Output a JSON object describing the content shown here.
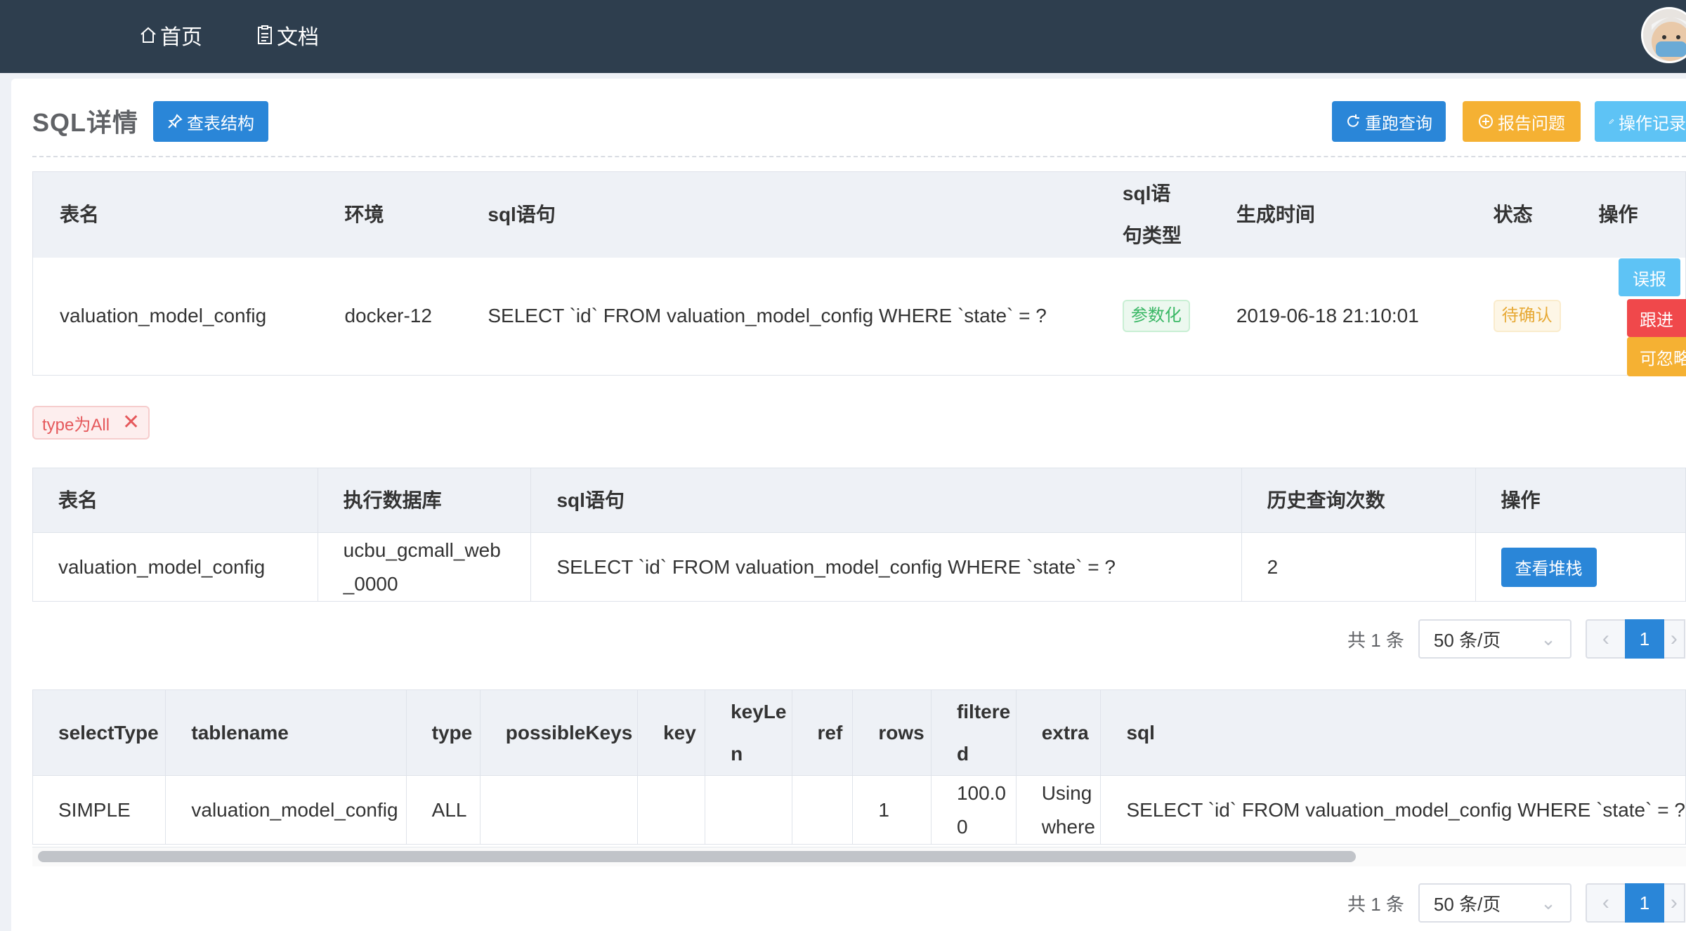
{
  "nav": {
    "home_label": "首页",
    "docs_label": "文档"
  },
  "header": {
    "title": "SQL详情",
    "view_structure_label": "查表结构",
    "rerun_label": "重跑查询",
    "report_label": "报告问题",
    "log_label": "操作记录"
  },
  "summary_table": {
    "headers": [
      "表名",
      "环境",
      "sql语句",
      "sql语句类型",
      "生成时间",
      "状态",
      "操作"
    ],
    "sql_type_header_line1": "sql语",
    "sql_type_header_line2": "句类型",
    "row": {
      "table_name": "valuation_model_config",
      "env": "docker-12",
      "sql": "SELECT `id` FROM valuation_model_config WHERE `state` = ?",
      "sql_type": "参数化",
      "created_at": "2019-06-18 21:10:01",
      "status": "待确认"
    },
    "actions": {
      "false_report": "误报",
      "follow": "跟进",
      "ignorable": "可忽略"
    }
  },
  "filter_tag": {
    "label": "type为All",
    "close": "✕"
  },
  "detail_table": {
    "headers": [
      "表名",
      "执行数据库",
      "sql语句",
      "历史查询次数",
      "操作"
    ],
    "row": {
      "table_name": "valuation_model_config",
      "db_line1": "ucbu_gcmall_web",
      "db_line2": "_0000",
      "sql": "SELECT `id` FROM valuation_model_config WHERE `state` = ?",
      "count": "2",
      "action": "查看堆栈"
    }
  },
  "pager1": {
    "total": "共 1 条",
    "page_size": "50 条/页",
    "current": "1"
  },
  "explain_table": {
    "headers": {
      "selectType": "selectType",
      "tablename": "tablename",
      "type": "type",
      "possibleKeys": "possibleKeys",
      "key": "key",
      "keyLen_line1": "keyLe",
      "keyLen_line2": "n",
      "ref": "ref",
      "rows": "rows",
      "filtered_line1": "filtere",
      "filtered_line2": "d",
      "extra": "extra",
      "sql": "sql"
    },
    "row": {
      "selectType": "SIMPLE",
      "tablename": "valuation_model_config",
      "type": "ALL",
      "possibleKeys": "",
      "key": "",
      "keyLen": "",
      "ref": "",
      "rows": "1",
      "filtered_line1": "100.0",
      "filtered_line2": "0",
      "extra_line1": "Using",
      "extra_line2": "where",
      "sql": "SELECT `id` FROM valuation_model_config WHERE `state` = ?"
    }
  },
  "pager2": {
    "total": "共 1 条",
    "page_size": "50 条/页",
    "current": "1"
  },
  "colors": {
    "topbar": "#2e3e4e",
    "primary": "#2a86d8",
    "warning": "#f5b133",
    "danger": "#f0484b",
    "info": "#5ec3f5"
  }
}
